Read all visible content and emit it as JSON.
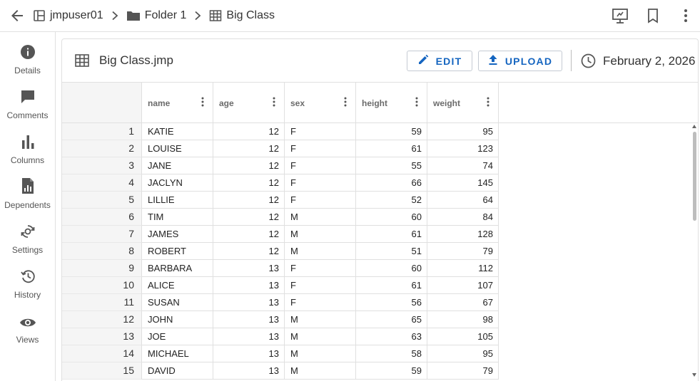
{
  "breadcrumb": {
    "items": [
      {
        "label": "jmpuser01",
        "icon": "space-icon"
      },
      {
        "label": "Folder 1",
        "icon": "folder-icon"
      },
      {
        "label": "Big Class",
        "icon": "table-icon"
      }
    ]
  },
  "toolbar": {
    "icons": [
      "presentation-icon",
      "bookmark-icon",
      "more-vert-icon"
    ]
  },
  "sidebar": {
    "items": [
      {
        "label": "Details",
        "icon": "info-icon"
      },
      {
        "label": "Comments",
        "icon": "comment-icon"
      },
      {
        "label": "Columns",
        "icon": "bar-chart-icon"
      },
      {
        "label": "Dependents",
        "icon": "report-file-icon"
      },
      {
        "label": "Settings",
        "icon": "settings-sync-icon"
      },
      {
        "label": "History",
        "icon": "history-icon"
      },
      {
        "label": "Views",
        "icon": "eye-icon"
      }
    ]
  },
  "file": {
    "title": "Big Class.jmp",
    "edit_label": "EDIT",
    "upload_label": "UPLOAD",
    "date": "February 2, 2026"
  },
  "colors": {
    "accent": "#1565c0",
    "border": "#e0e0e0",
    "rownum_bg": "#f5f5f5"
  },
  "table": {
    "columns": [
      {
        "name": "name",
        "align": "left"
      },
      {
        "name": "age",
        "align": "right"
      },
      {
        "name": "sex",
        "align": "left"
      },
      {
        "name": "height",
        "align": "right"
      },
      {
        "name": "weight",
        "align": "right"
      }
    ],
    "rows": [
      {
        "n": "1",
        "cells": [
          "KATIE",
          "12",
          "F",
          "59",
          "95"
        ]
      },
      {
        "n": "2",
        "cells": [
          "LOUISE",
          "12",
          "F",
          "61",
          "123"
        ]
      },
      {
        "n": "3",
        "cells": [
          "JANE",
          "12",
          "F",
          "55",
          "74"
        ]
      },
      {
        "n": "4",
        "cells": [
          "JACLYN",
          "12",
          "F",
          "66",
          "145"
        ]
      },
      {
        "n": "5",
        "cells": [
          "LILLIE",
          "12",
          "F",
          "52",
          "64"
        ]
      },
      {
        "n": "6",
        "cells": [
          "TIM",
          "12",
          "M",
          "60",
          "84"
        ]
      },
      {
        "n": "7",
        "cells": [
          "JAMES",
          "12",
          "M",
          "61",
          "128"
        ]
      },
      {
        "n": "8",
        "cells": [
          "ROBERT",
          "12",
          "M",
          "51",
          "79"
        ]
      },
      {
        "n": "9",
        "cells": [
          "BARBARA",
          "13",
          "F",
          "60",
          "112"
        ]
      },
      {
        "n": "10",
        "cells": [
          "ALICE",
          "13",
          "F",
          "61",
          "107"
        ]
      },
      {
        "n": "11",
        "cells": [
          "SUSAN",
          "13",
          "F",
          "56",
          "67"
        ]
      },
      {
        "n": "12",
        "cells": [
          "JOHN",
          "13",
          "M",
          "65",
          "98"
        ]
      },
      {
        "n": "13",
        "cells": [
          "JOE",
          "13",
          "M",
          "63",
          "105"
        ]
      },
      {
        "n": "14",
        "cells": [
          "MICHAEL",
          "13",
          "M",
          "58",
          "95"
        ]
      },
      {
        "n": "15",
        "cells": [
          "DAVID",
          "13",
          "M",
          "59",
          "79"
        ]
      }
    ]
  }
}
